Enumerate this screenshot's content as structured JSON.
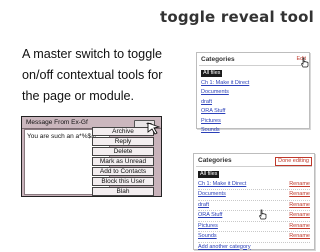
{
  "slide": {
    "title": "toggle reveal tool",
    "description": "A master switch to toggle on/off  contextual tools for the page or module."
  },
  "message_window": {
    "title": "Message From Ex-Gf",
    "body_text": "You are such an a*%$#!",
    "menu_items": [
      "Archive",
      "Reply",
      "Delete",
      "Mark as Unread",
      "Add to Contacts",
      "Block this User",
      "Blah"
    ]
  },
  "categories_panel_collapsed": {
    "heading": "Categories",
    "edit_label": "Edit",
    "all_label": "All files",
    "items": [
      "Ch 1: Make it Direct",
      "Documents",
      "draft",
      "ORA Stuff",
      "Pictures",
      "Sounds"
    ]
  },
  "categories_panel_expanded": {
    "heading": "Categories",
    "done_label": "Done editing",
    "all_label": "All files",
    "items": [
      "Ch 1: Make it Direct",
      "Documents",
      "draft",
      "ORA Stuff",
      "Pictures",
      "Sounds"
    ],
    "rename_label": "Rename",
    "add_label": "Add another category"
  }
}
